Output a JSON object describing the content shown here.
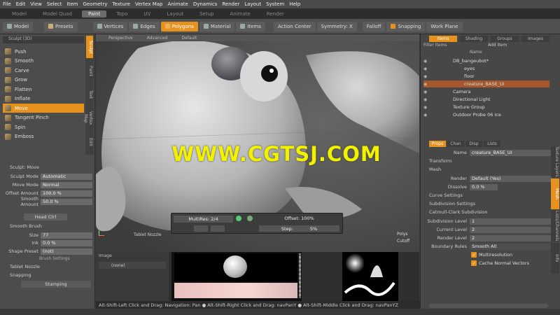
{
  "menubar": [
    "File",
    "Edit",
    "View",
    "Select",
    "Item",
    "Geometry",
    "Texture",
    "Vertex Map",
    "Animate",
    "Dynamics",
    "Render",
    "Layout",
    "System",
    "Help"
  ],
  "tabs": [
    "Model",
    "Model Quad",
    "Paint",
    "Topo",
    "UV",
    "Layout",
    "Setup",
    "Animate",
    "Render"
  ],
  "active_tab": "Paint",
  "toolbar": {
    "model": "Model",
    "presets": "Presets",
    "vertices": "Vertices",
    "edges": "Edges",
    "polygons": "Polygons",
    "material": "Material",
    "items": "Items",
    "action_center": "Action Center",
    "symmetry": "Symmetry: X",
    "falloff": "Falloff",
    "snapping": "Snapping",
    "work_plane": "Work Plane"
  },
  "left_panel": {
    "header": "Sculpt (3D)",
    "tools": [
      "Push",
      "Smooth",
      "Carve",
      "Grow",
      "Flatten",
      "Inflate",
      "Move",
      "Tangent Pinch",
      "Spin",
      "Emboss"
    ],
    "selected_tool": "Move",
    "vtabs": [
      "Sculpt",
      "Paint",
      "Text",
      "Vertex Map",
      "Edit"
    ],
    "sculpt_mode_header": "Sculpt: Move",
    "props": [
      {
        "label": "Sculpt Mode",
        "value": "Automatic"
      },
      {
        "label": "Move Mode",
        "value": "Normal"
      },
      {
        "label": "Offset Amount",
        "value": "100.0 %"
      },
      {
        "label": "Smooth Amount",
        "value": "50.0 %"
      }
    ],
    "head_btn": "Head Ctrl",
    "smooth_header": "Smooth Brush",
    "brush_props": [
      {
        "label": "Size",
        "value": "77"
      },
      {
        "label": "Ink",
        "value": "0.0 %"
      }
    ],
    "shape_preset": {
      "label": "Shape Preset",
      "value": "(not)"
    },
    "brush_settings": "Brush Settings",
    "tablet_nozzle": "Tablet Nozzle",
    "snapping": "Snapping",
    "snapping_value": "Stamping"
  },
  "viewport": {
    "header_items": [
      "Perspective",
      "Advanced",
      "Default"
    ],
    "watermark": "WWW.CGTSJ.COM",
    "multires": {
      "label": "MultiRes: 2/4",
      "offset_label": "Offset: 100%",
      "step_label": "Step:",
      "step_value": "5%"
    },
    "tablet_nozzle": "Tablet Nozzle",
    "info_polys": "Polys",
    "info_extra": "Cutoff"
  },
  "bottom": {
    "left_header": "Image",
    "left_item": "(none)"
  },
  "right_panel": {
    "tabs": [
      "Items",
      "Shading",
      "Groups",
      "Images"
    ],
    "filter_label": "Filter items",
    "add_item": "Add Item",
    "tree_header": "Name",
    "tree": [
      {
        "name": "DB_bangeubot*",
        "indent": 2
      },
      {
        "name": "eyes",
        "indent": 3
      },
      {
        "name": "floor",
        "indent": 3
      },
      {
        "name": "creature_BASE_UI",
        "indent": 3,
        "selected": true
      },
      {
        "name": "Camera",
        "indent": 2
      },
      {
        "name": "Directional Light",
        "indent": 2
      },
      {
        "name": "Texture Group",
        "indent": 2
      },
      {
        "name": "Outdoor Probe 06 Ice",
        "indent": 2
      }
    ],
    "prop_tabs": [
      "Props",
      "Chan",
      "Disp",
      "Lists"
    ],
    "name_label": "Name",
    "name_value": "creature_BASE_UI",
    "sections": [
      "Transform",
      "Mesh"
    ],
    "render_label": "Render",
    "render_value": "Default (Yes)",
    "dissolve_label": "Dissolve",
    "dissolve_value": "0.0 %",
    "curve_settings": "Curve Settings",
    "subdiv_settings": "Subdivision Settings",
    "catmull_header": "Catmull-Clark Subdivision",
    "subdiv_rows": [
      {
        "label": "Subdivision Level",
        "value": "1"
      },
      {
        "label": "Current Level",
        "value": "2"
      },
      {
        "label": "Render Level",
        "value": "2"
      }
    ],
    "boundary_label": "Boundary Rules",
    "boundary_value": "Smooth All",
    "checks": [
      "Multiresolution",
      "Cache Normal Vectors"
    ],
    "vtabs": [
      "Texture Layers",
      "Mesh",
      "Lists/Channels",
      "Info"
    ]
  },
  "statusbar": "Alt-Shift-Left Click and Drag: Navigation: Pan  ●  Alt-Shift-Right Click and Drag: navPanY  ●  Alt-Shift-Middle Click and Drag: navPanYZ"
}
